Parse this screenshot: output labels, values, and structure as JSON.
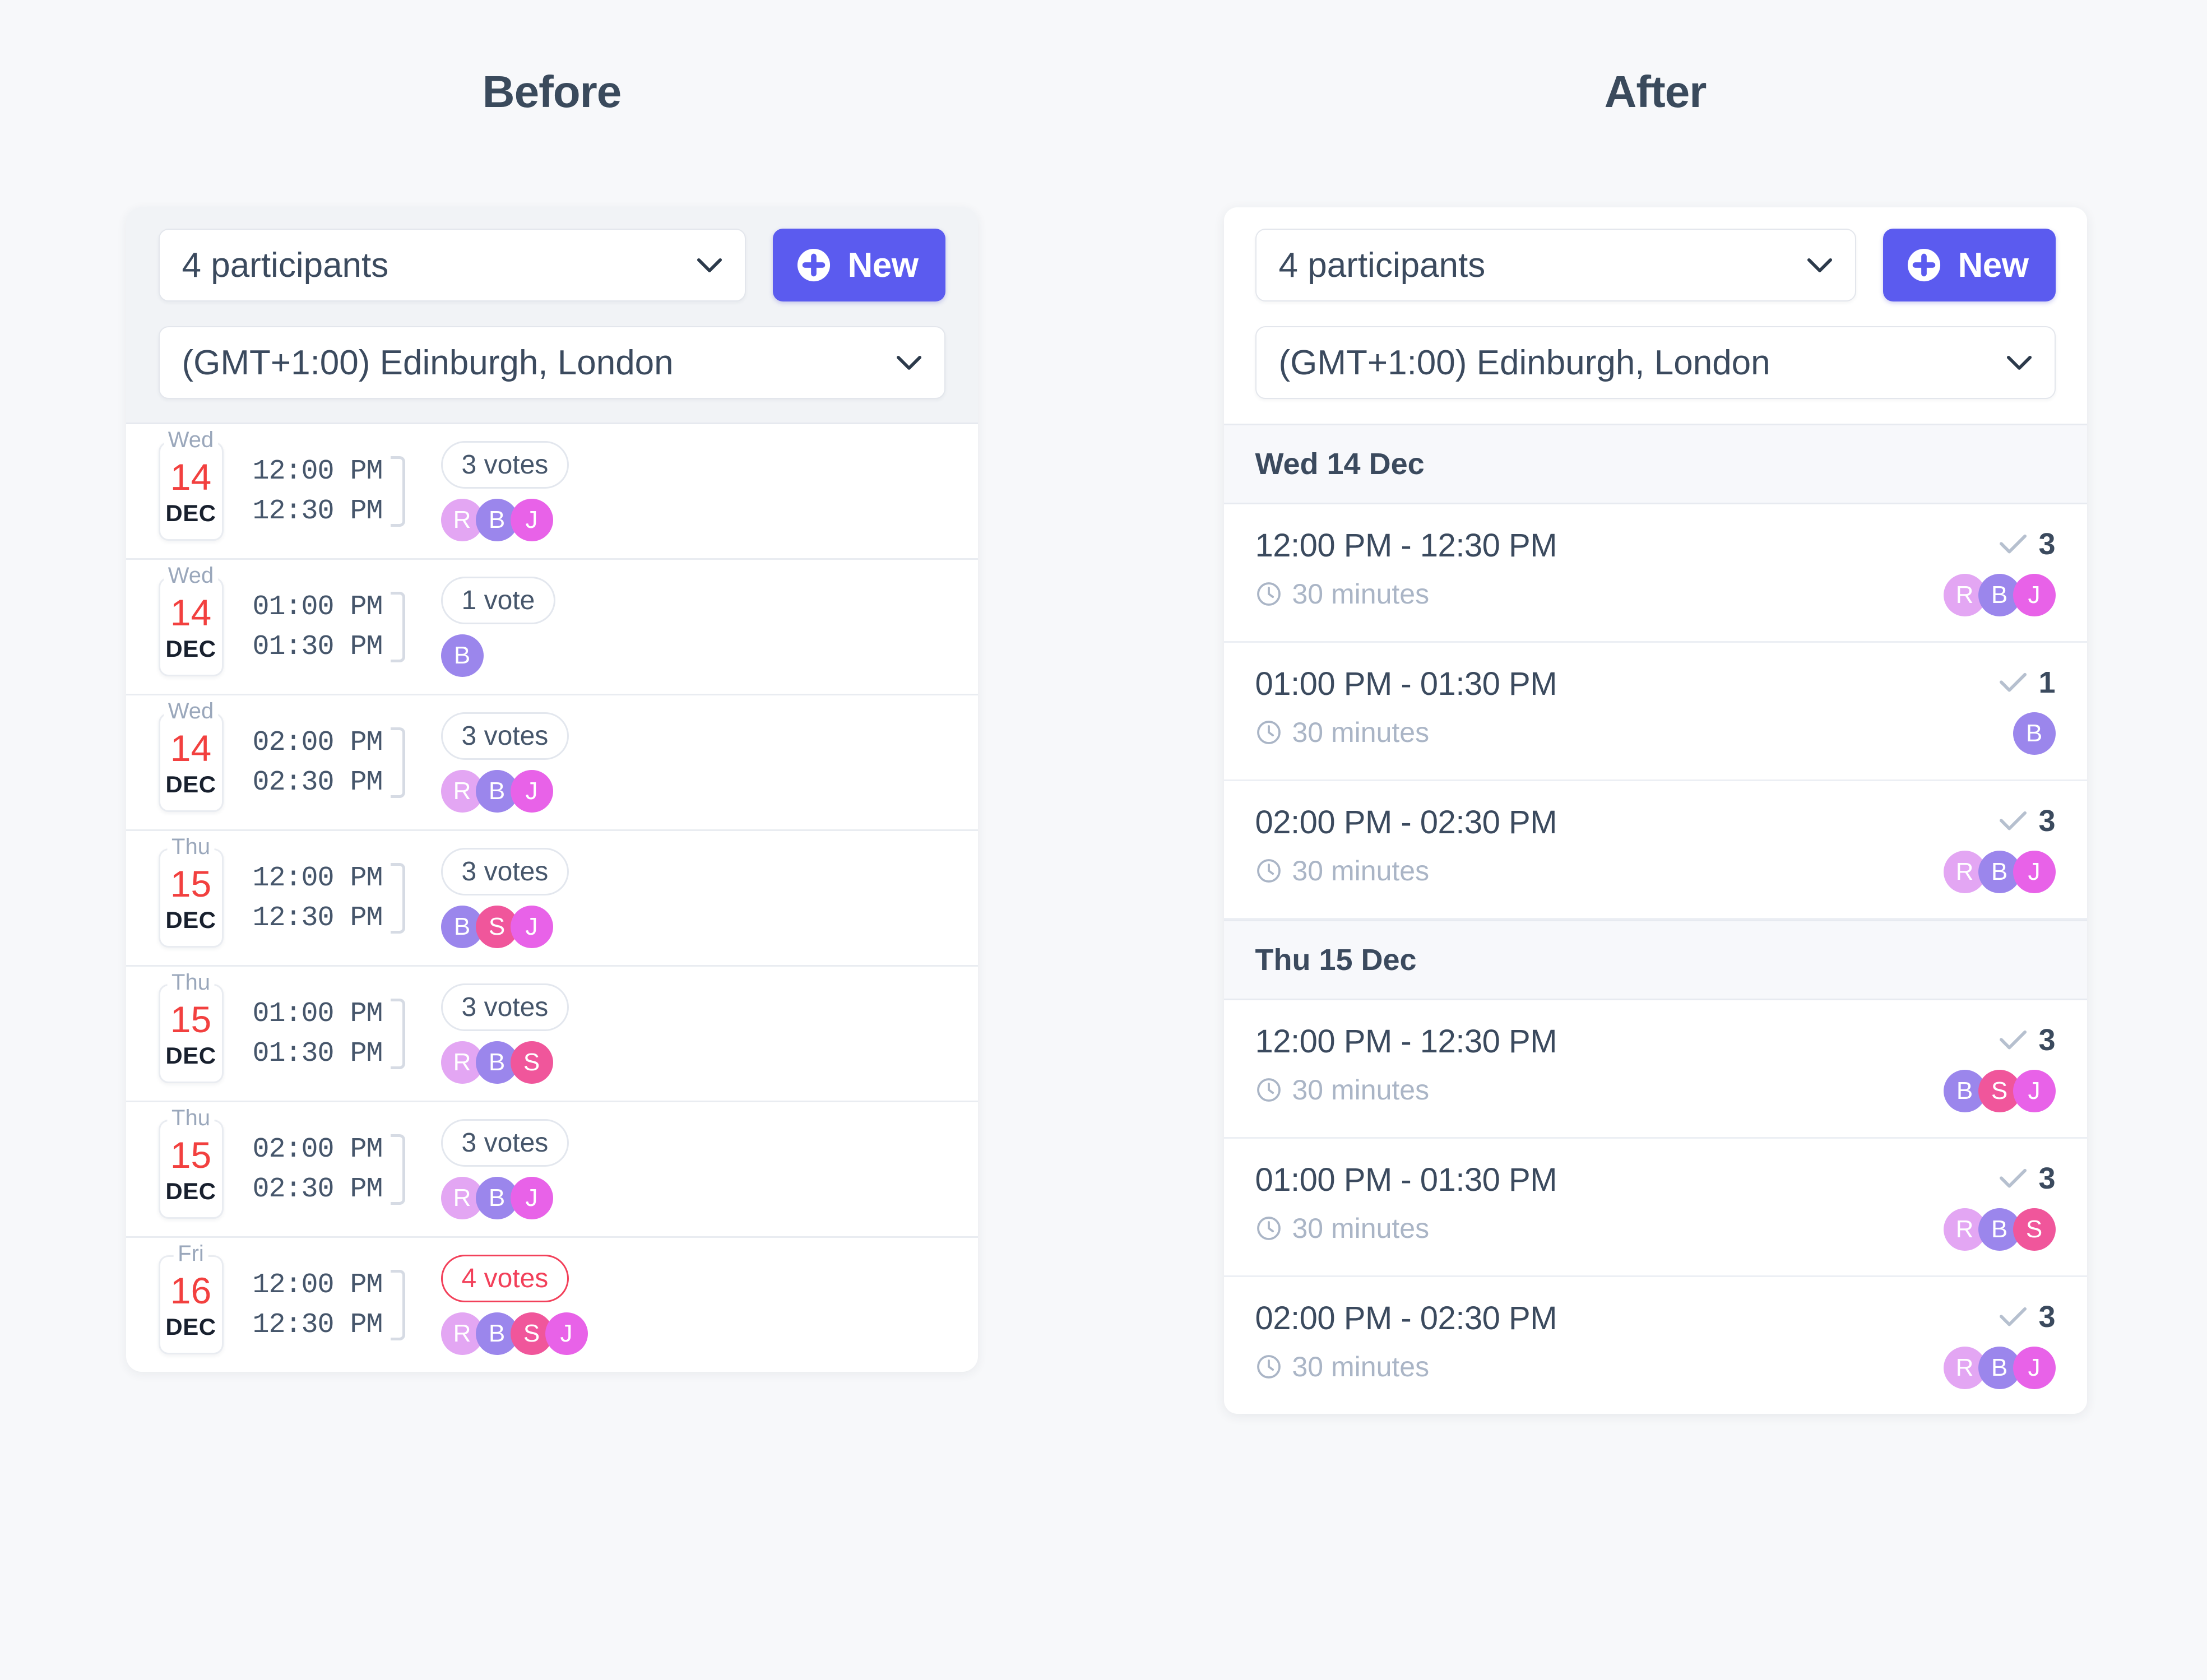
{
  "columns": {
    "before_title": "Before",
    "after_title": "After"
  },
  "colors": {
    "accent": "#5b5bef",
    "danger": "#f2405a",
    "date_number": "#f2403f",
    "text": "#3b4a5e",
    "muted": "#aab5c6",
    "avatar_R": "#e3a6f3",
    "avatar_B": "#9b86ec",
    "avatar_J": "#e862e8",
    "avatar_S": "#f0569b"
  },
  "toolbar": {
    "participants_value": "4 participants",
    "timezone_value": "(GMT+1:00) Edinburgh, London",
    "new_label": "New"
  },
  "before": {
    "rows": [
      {
        "dow": "Wed",
        "day": "14",
        "month": "DEC",
        "start": "12:00 PM",
        "end": "12:30 PM",
        "votes_label": "3 votes",
        "highlight": false,
        "avatars": [
          {
            "initial": "R",
            "color": "#e3a6f3"
          },
          {
            "initial": "B",
            "color": "#9b86ec"
          },
          {
            "initial": "J",
            "color": "#e862e8"
          }
        ]
      },
      {
        "dow": "Wed",
        "day": "14",
        "month": "DEC",
        "start": "01:00 PM",
        "end": "01:30 PM",
        "votes_label": "1 vote",
        "highlight": false,
        "avatars": [
          {
            "initial": "B",
            "color": "#9b86ec"
          }
        ]
      },
      {
        "dow": "Wed",
        "day": "14",
        "month": "DEC",
        "start": "02:00 PM",
        "end": "02:30 PM",
        "votes_label": "3 votes",
        "highlight": false,
        "avatars": [
          {
            "initial": "R",
            "color": "#e3a6f3"
          },
          {
            "initial": "B",
            "color": "#9b86ec"
          },
          {
            "initial": "J",
            "color": "#e862e8"
          }
        ]
      },
      {
        "dow": "Thu",
        "day": "15",
        "month": "DEC",
        "start": "12:00 PM",
        "end": "12:30 PM",
        "votes_label": "3 votes",
        "highlight": false,
        "avatars": [
          {
            "initial": "B",
            "color": "#9b86ec"
          },
          {
            "initial": "S",
            "color": "#f0569b"
          },
          {
            "initial": "J",
            "color": "#e862e8"
          }
        ]
      },
      {
        "dow": "Thu",
        "day": "15",
        "month": "DEC",
        "start": "01:00 PM",
        "end": "01:30 PM",
        "votes_label": "3 votes",
        "highlight": false,
        "avatars": [
          {
            "initial": "R",
            "color": "#e3a6f3"
          },
          {
            "initial": "B",
            "color": "#9b86ec"
          },
          {
            "initial": "S",
            "color": "#f0569b"
          }
        ]
      },
      {
        "dow": "Thu",
        "day": "15",
        "month": "DEC",
        "start": "02:00 PM",
        "end": "02:30 PM",
        "votes_label": "3 votes",
        "highlight": false,
        "avatars": [
          {
            "initial": "R",
            "color": "#e3a6f3"
          },
          {
            "initial": "B",
            "color": "#9b86ec"
          },
          {
            "initial": "J",
            "color": "#e862e8"
          }
        ]
      },
      {
        "dow": "Fri",
        "day": "16",
        "month": "DEC",
        "start": "12:00 PM",
        "end": "12:30 PM",
        "votes_label": "4 votes",
        "highlight": true,
        "avatars": [
          {
            "initial": "R",
            "color": "#e3a6f3"
          },
          {
            "initial": "B",
            "color": "#9b86ec"
          },
          {
            "initial": "S",
            "color": "#f0569b"
          },
          {
            "initial": "J",
            "color": "#e862e8"
          }
        ]
      }
    ]
  },
  "after": {
    "sections": [
      {
        "header": "Wed 14 Dec",
        "rows": [
          {
            "time_range": "12:00 PM - 12:30 PM",
            "duration": "30 minutes",
            "count": "3",
            "avatars": [
              {
                "initial": "R",
                "color": "#e3a6f3"
              },
              {
                "initial": "B",
                "color": "#9b86ec"
              },
              {
                "initial": "J",
                "color": "#e862e8"
              }
            ]
          },
          {
            "time_range": "01:00 PM - 01:30 PM",
            "duration": "30 minutes",
            "count": "1",
            "avatars": [
              {
                "initial": "B",
                "color": "#9b86ec"
              }
            ]
          },
          {
            "time_range": "02:00 PM - 02:30 PM",
            "duration": "30 minutes",
            "count": "3",
            "avatars": [
              {
                "initial": "R",
                "color": "#e3a6f3"
              },
              {
                "initial": "B",
                "color": "#9b86ec"
              },
              {
                "initial": "J",
                "color": "#e862e8"
              }
            ]
          }
        ]
      },
      {
        "header": "Thu 15 Dec",
        "rows": [
          {
            "time_range": "12:00 PM - 12:30 PM",
            "duration": "30 minutes",
            "count": "3",
            "avatars": [
              {
                "initial": "B",
                "color": "#9b86ec"
              },
              {
                "initial": "S",
                "color": "#f0569b"
              },
              {
                "initial": "J",
                "color": "#e862e8"
              }
            ]
          },
          {
            "time_range": "01:00 PM - 01:30 PM",
            "duration": "30 minutes",
            "count": "3",
            "avatars": [
              {
                "initial": "R",
                "color": "#e3a6f3"
              },
              {
                "initial": "B",
                "color": "#9b86ec"
              },
              {
                "initial": "S",
                "color": "#f0569b"
              }
            ]
          },
          {
            "time_range": "02:00 PM - 02:30 PM",
            "duration": "30 minutes",
            "count": "3",
            "avatars": [
              {
                "initial": "R",
                "color": "#e3a6f3"
              },
              {
                "initial": "B",
                "color": "#9b86ec"
              },
              {
                "initial": "J",
                "color": "#e862e8"
              }
            ]
          }
        ]
      }
    ]
  }
}
